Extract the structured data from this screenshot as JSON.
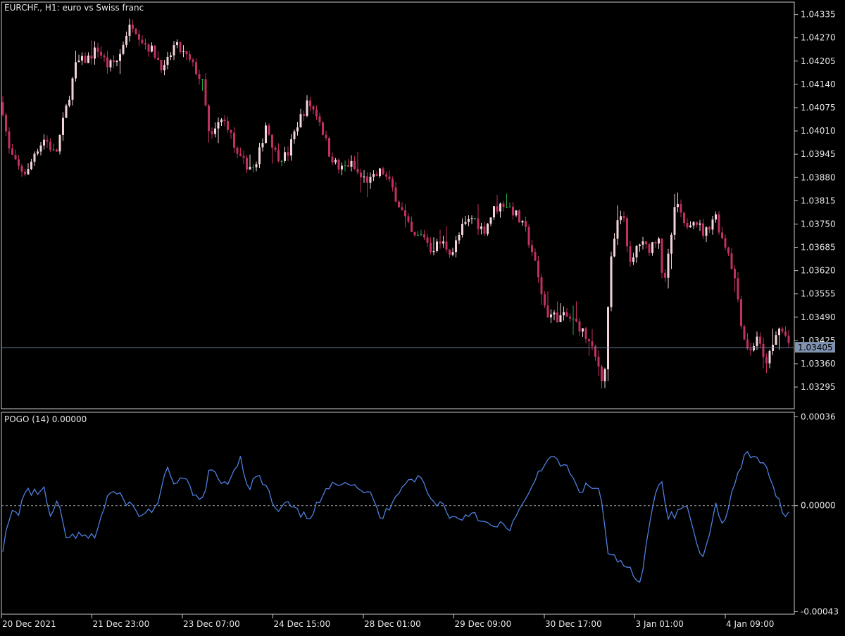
{
  "theme": {
    "background": "#000000",
    "frame": "#c8c8c8",
    "text": "#e6e6e6",
    "bull": "#f2d4d8",
    "bear": "#c03060",
    "doji": "#22aa44",
    "bid_line": "#6a7ca0",
    "bid_label_bg": "#7f93b0",
    "pogo_line": "#4f7fe0",
    "zero_line": "#9a9a9a"
  },
  "chart_data": [
    {
      "type": "candlestick",
      "title": "EURCHF., H1:  euro vs Swiss franc",
      "symbol": "EURCHF.",
      "timeframe": "H1",
      "description": "euro vs Swiss franc",
      "y_ticks": [
        "1.04335",
        "1.04270",
        "1.04205",
        "1.04140",
        "1.04075",
        "1.04010",
        "1.03945",
        "1.03880",
        "1.03815",
        "1.03750",
        "1.03685",
        "1.03620",
        "1.03555",
        "1.03490",
        "1.03425",
        "1.03360",
        "1.03295"
      ],
      "ylim": [
        1.0324,
        1.04365
      ],
      "current_price": "1.03405",
      "current_value": 1.03405,
      "close_path": [
        [
          0,
          1.0407
        ],
        [
          8,
          1.0396
        ],
        [
          20,
          1.0391
        ],
        [
          35,
          1.0389
        ],
        [
          45,
          1.0395
        ],
        [
          60,
          1.0399
        ],
        [
          75,
          1.0394
        ],
        [
          90,
          1.0407
        ],
        [
          105,
          1.042
        ],
        [
          120,
          1.0421
        ],
        [
          135,
          1.0424
        ],
        [
          150,
          1.0419
        ],
        [
          165,
          1.0421
        ],
        [
          175,
          1.0428
        ],
        [
          185,
          1.0431
        ],
        [
          200,
          1.0426
        ],
        [
          215,
          1.0423
        ],
        [
          230,
          1.0418
        ],
        [
          245,
          1.0425
        ],
        [
          260,
          1.0422
        ],
        [
          275,
          1.0418
        ],
        [
          285,
          1.0414
        ],
        [
          295,
          1.0398
        ],
        [
          310,
          1.0404
        ],
        [
          320,
          1.0403
        ],
        [
          335,
          1.0393
        ],
        [
          345,
          1.0392
        ],
        [
          360,
          1.039
        ],
        [
          375,
          1.0403
        ],
        [
          390,
          1.0394
        ],
        [
          405,
          1.0394
        ],
        [
          420,
          1.0403
        ],
        [
          435,
          1.0409
        ],
        [
          450,
          1.0405
        ],
        [
          465,
          1.0395
        ],
        [
          480,
          1.039
        ],
        [
          495,
          1.0392
        ],
        [
          510,
          1.0388
        ],
        [
          525,
          1.0387
        ],
        [
          540,
          1.039
        ],
        [
          555,
          1.0385
        ],
        [
          570,
          1.0378
        ],
        [
          585,
          1.0371
        ],
        [
          600,
          1.0372
        ],
        [
          610,
          1.0368
        ],
        [
          625,
          1.037
        ],
        [
          640,
          1.0367
        ],
        [
          655,
          1.0374
        ],
        [
          670,
          1.0377
        ],
        [
          685,
          1.0373
        ],
        [
          700,
          1.0379
        ],
        [
          715,
          1.0381
        ],
        [
          730,
          1.0378
        ],
        [
          745,
          1.0373
        ],
        [
          755,
          1.0367
        ],
        [
          765,
          1.0358
        ],
        [
          775,
          1.035
        ],
        [
          790,
          1.0349
        ],
        [
          805,
          1.0349
        ],
        [
          820,
          1.0347
        ],
        [
          835,
          1.0342
        ],
        [
          850,
          1.0335
        ],
        [
          857,
          1.033
        ],
        [
          865,
          1.0362
        ],
        [
          875,
          1.0375
        ],
        [
          885,
          1.0377
        ],
        [
          895,
          1.0362
        ],
        [
          905,
          1.037
        ],
        [
          920,
          1.0368
        ],
        [
          935,
          1.0372
        ],
        [
          942,
          1.0356
        ],
        [
          950,
          1.0368
        ],
        [
          960,
          1.0382
        ],
        [
          970,
          1.0374
        ],
        [
          985,
          1.0377
        ],
        [
          1000,
          1.0372
        ],
        [
          1015,
          1.0378
        ],
        [
          1025,
          1.0371
        ],
        [
          1035,
          1.0367
        ],
        [
          1045,
          1.0358
        ],
        [
          1055,
          1.0344
        ],
        [
          1065,
          1.0339
        ],
        [
          1075,
          1.0344
        ],
        [
          1085,
          1.0336
        ],
        [
          1095,
          1.0339
        ],
        [
          1105,
          1.0346
        ],
        [
          1115,
          1.0344
        ],
        [
          1124,
          1.034
        ]
      ]
    },
    {
      "type": "line",
      "title": "POGO (14) 0.00000",
      "name": "POGO",
      "period": 14,
      "current_value": "0.00000",
      "y_ticks": [
        "0.00036",
        "0.00000",
        "-0.00043"
      ],
      "ylim": [
        -0.00043,
        0.00036
      ],
      "zero_level": 0.0,
      "series_path": [
        [
          0,
          -0.00017
        ],
        [
          12,
          -3e-05
        ],
        [
          22,
          -3e-05
        ],
        [
          32,
          6e-05
        ],
        [
          45,
          5e-05
        ],
        [
          58,
          7e-05
        ],
        [
          68,
          -5e-05
        ],
        [
          78,
          1e-05
        ],
        [
          92,
          -0.00014
        ],
        [
          105,
          -0.00012
        ],
        [
          118,
          -0.00013
        ],
        [
          130,
          -0.00013
        ],
        [
          142,
          -3e-05
        ],
        [
          152,
          6e-05
        ],
        [
          165,
          4e-05
        ],
        [
          180,
          1e-05
        ],
        [
          195,
          -4e-05
        ],
        [
          210,
          -2e-05
        ],
        [
          222,
          1e-05
        ],
        [
          234,
          0.00015
        ],
        [
          246,
          9e-05
        ],
        [
          258,
          0.00011
        ],
        [
          270,
          5e-05
        ],
        [
          283,
          1e-05
        ],
        [
          296,
          0.00016
        ],
        [
          308,
          9e-05
        ],
        [
          322,
          0.0001
        ],
        [
          338,
          0.0002
        ],
        [
          350,
          7e-05
        ],
        [
          362,
          0.00012
        ],
        [
          375,
          8e-05
        ],
        [
          390,
          -3e-05
        ],
        [
          405,
          1e-05
        ],
        [
          420,
          -3e-05
        ],
        [
          435,
          -5e-05
        ],
        [
          450,
          1e-05
        ],
        [
          465,
          7e-05
        ],
        [
          480,
          0.0001
        ],
        [
          495,
          0.0001
        ],
        [
          510,
          7e-05
        ],
        [
          525,
          4e-05
        ],
        [
          540,
          -6e-05
        ],
        [
          555,
          2e-05
        ],
        [
          570,
          9e-05
        ],
        [
          585,
          0.00011
        ],
        [
          597,
          0.00011
        ],
        [
          610,
          2e-05
        ],
        [
          625,
          1e-05
        ],
        [
          640,
          -5e-05
        ],
        [
          655,
          -5e-05
        ],
        [
          670,
          -2e-05
        ],
        [
          685,
          -7e-05
        ],
        [
          698,
          -9e-05
        ],
        [
          710,
          -8e-05
        ],
        [
          722,
          -9e-05
        ],
        [
          735,
          -3e-05
        ],
        [
          748,
          3e-05
        ],
        [
          760,
          0.00012
        ],
        [
          775,
          0.00019
        ],
        [
          790,
          0.00018
        ],
        [
          805,
          0.00015
        ],
        [
          820,
          6e-05
        ],
        [
          835,
          8e-05
        ],
        [
          852,
          6e-05
        ],
        [
          862,
          -0.0002
        ],
        [
          875,
          -0.00022
        ],
        [
          890,
          -0.00025
        ],
        [
          900,
          -0.00029
        ],
        [
          910,
          -0.00033
        ],
        [
          918,
          -0.00012
        ],
        [
          928,
          4e-05
        ],
        [
          938,
          0.00011
        ],
        [
          948,
          -4e-05
        ],
        [
          960,
          -4e-05
        ],
        [
          972,
          1e-05
        ],
        [
          985,
          -0.0001
        ],
        [
          995,
          -0.00022
        ],
        [
          1005,
          -0.00013
        ],
        [
          1015,
          1e-05
        ],
        [
          1025,
          -8e-05
        ],
        [
          1035,
          1e-05
        ],
        [
          1048,
          0.00013
        ],
        [
          1060,
          0.00021
        ],
        [
          1072,
          0.00019
        ],
        [
          1085,
          0.00018
        ],
        [
          1095,
          8e-05
        ],
        [
          1105,
          3e-05
        ],
        [
          1115,
          -4e-05
        ],
        [
          1124,
          0.0
        ]
      ]
    }
  ],
  "x_ticks": [
    "20 Dec 2021",
    "21 Dec 23:00",
    "23 Dec 07:00",
    "24 Dec 15:00",
    "28 Dec 01:00",
    "29 Dec 09:00",
    "30 Dec 17:00",
    "3 Jan 01:00",
    "4 Jan 09:00"
  ]
}
